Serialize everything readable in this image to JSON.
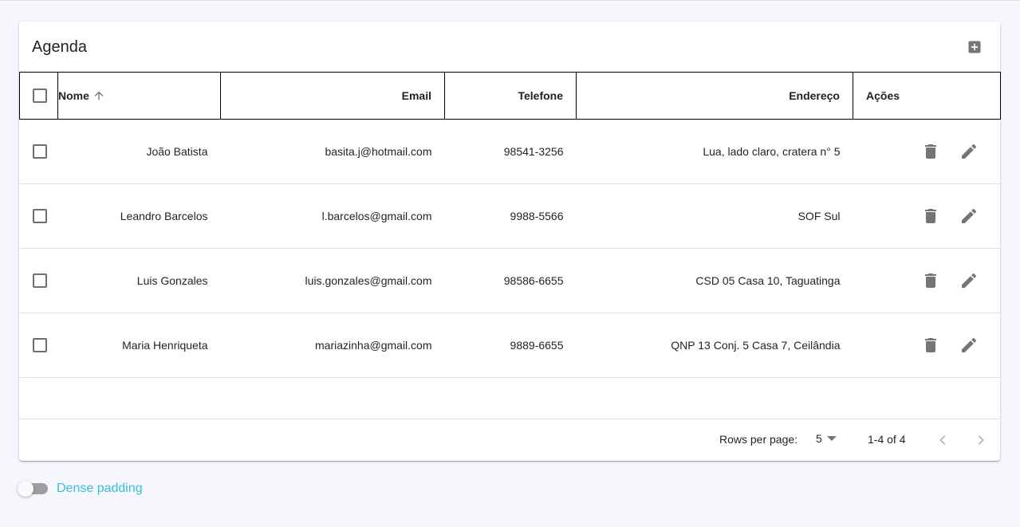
{
  "toolbar": {
    "title": "Agenda"
  },
  "table": {
    "headers": {
      "nome": "Nome",
      "email": "Email",
      "telefone": "Telefone",
      "endereco": "Endereço",
      "acoes": "Ações"
    },
    "rows": [
      {
        "nome": "João Batista",
        "email": "basita.j@hotmail.com",
        "telefone": "98541-3256",
        "endereco": "Lua, lado claro, cratera n° 5"
      },
      {
        "nome": "Leandro Barcelos",
        "email": "l.barcelos@gmail.com",
        "telefone": "9988-5566",
        "endereco": "SOF Sul"
      },
      {
        "nome": "Luis Gonzales",
        "email": "luis.gonzales@gmail.com",
        "telefone": "98586-6655",
        "endereco": "CSD 05 Casa 10, Taguatinga"
      },
      {
        "nome": "Maria Henriqueta",
        "email": "mariazinha@gmail.com",
        "telefone": "9889-6655",
        "endereco": "QNP 13 Conj. 5 Casa 7, Ceilândia"
      }
    ]
  },
  "pagination": {
    "rows_per_page_label": "Rows per page:",
    "rows_per_page": "5",
    "range": "1-4 of 4"
  },
  "dense": {
    "label": "Dense padding",
    "enabled": false
  },
  "colors": {
    "accent": "#38bcd9",
    "icon": "#757575"
  }
}
